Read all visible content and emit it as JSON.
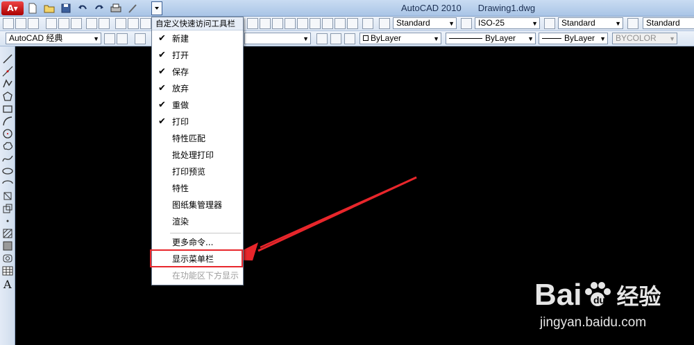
{
  "window": {
    "app_name": "AutoCAD 2010",
    "document": "Drawing1.dwg"
  },
  "qat": {
    "icons": [
      "new-icon",
      "open-icon",
      "save-icon",
      "undo-icon",
      "redo-icon",
      "plot-icon",
      "customize-dropdown-icon"
    ]
  },
  "toolbar_row1": {
    "text_style": "Standard",
    "dim_style": "ISO-25",
    "table_style": "Standard",
    "multileader_style": "Standard"
  },
  "toolbar_row2": {
    "workspace": "AutoCAD 经典",
    "color": "ByLayer",
    "linetype": "ByLayer",
    "lineweight": "ByLayer",
    "plotstyle": "BYCOLOR"
  },
  "menu": {
    "header": "自定义快速访问工具栏",
    "items": [
      {
        "label": "新建",
        "checked": true
      },
      {
        "label": "打开",
        "checked": true
      },
      {
        "label": "保存",
        "checked": true
      },
      {
        "label": "放弃",
        "checked": true
      },
      {
        "label": "重做",
        "checked": true
      },
      {
        "label": "打印",
        "checked": true
      },
      {
        "label": "特性匹配",
        "checked": false
      },
      {
        "label": "批处理打印",
        "checked": false
      },
      {
        "label": "打印预览",
        "checked": false
      },
      {
        "label": "特性",
        "checked": false
      },
      {
        "label": "图纸集管理器",
        "checked": false
      },
      {
        "label": "渲染",
        "checked": false
      }
    ],
    "more_commands": "更多命令...",
    "show_menu_bar": "显示菜单栏",
    "show_below_ribbon": "在功能区下方显示"
  },
  "watermark": {
    "brand_a": "Bai",
    "brand_b": "经验",
    "url": "jingyan.baidu.com"
  },
  "colors": {
    "canvas": "#000000",
    "annotation_red": "#e8262b",
    "menu_bg": "#ffffff"
  }
}
